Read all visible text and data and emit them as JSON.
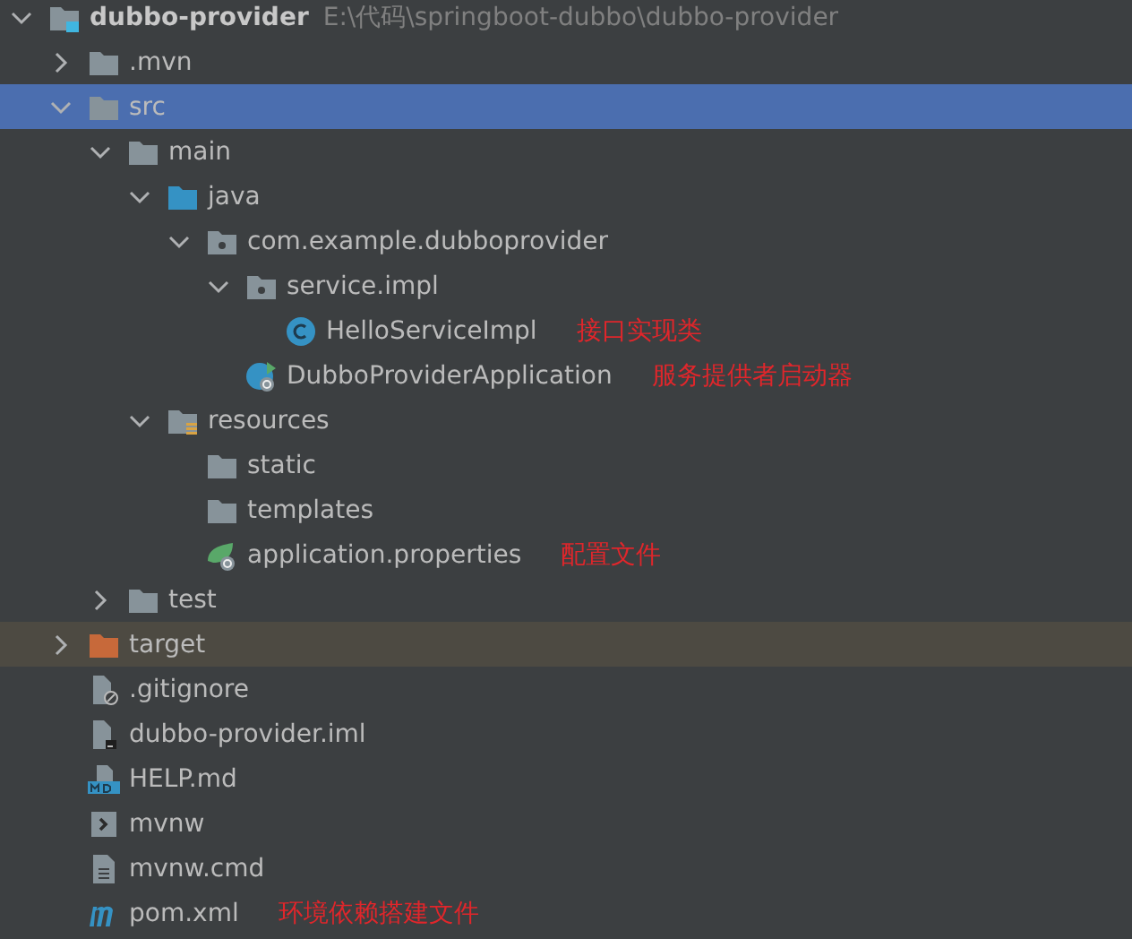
{
  "tree": {
    "label": "dubbo-provider",
    "path": "E:\\代码\\springboot-dubbo\\dubbo-provider",
    "kind": "module",
    "expanded": true,
    "selected": false,
    "children": [
      {
        "label": ".mvn",
        "kind": "folder",
        "expanded": false,
        "selected": false
      },
      {
        "label": "src",
        "kind": "folder",
        "expanded": true,
        "selected": true,
        "children": [
          {
            "label": "main",
            "kind": "folder",
            "expanded": true,
            "selected": false,
            "children": [
              {
                "label": "java",
                "kind": "source-folder",
                "expanded": true,
                "selected": false,
                "children": [
                  {
                    "label": "com.example.dubboprovider",
                    "kind": "package",
                    "expanded": true,
                    "selected": false,
                    "children": [
                      {
                        "label": "service.impl",
                        "kind": "package",
                        "expanded": true,
                        "selected": false,
                        "children": [
                          {
                            "label": "HelloServiceImpl",
                            "kind": "class",
                            "selected": false,
                            "note": "接口实现类"
                          }
                        ]
                      },
                      {
                        "label": "DubboProviderApplication",
                        "kind": "app-class",
                        "selected": false,
                        "note": "服务提供者启动器"
                      }
                    ]
                  }
                ]
              },
              {
                "label": "resources",
                "kind": "resources-folder",
                "expanded": true,
                "selected": false,
                "children": [
                  {
                    "label": "static",
                    "kind": "folder",
                    "selected": false
                  },
                  {
                    "label": "templates",
                    "kind": "folder",
                    "selected": false
                  },
                  {
                    "label": "application.properties",
                    "kind": "properties",
                    "selected": false,
                    "note": "配置文件"
                  }
                ]
              }
            ]
          },
          {
            "label": "test",
            "kind": "folder",
            "expanded": false,
            "selected": false
          }
        ]
      },
      {
        "label": "target",
        "kind": "excluded-folder",
        "expanded": false,
        "selected": false
      },
      {
        "label": ".gitignore",
        "kind": "ignore-file",
        "selected": false
      },
      {
        "label": "dubbo-provider.iml",
        "kind": "iml-file",
        "selected": false
      },
      {
        "label": "HELP.md",
        "kind": "markdown",
        "selected": false
      },
      {
        "label": "mvnw",
        "kind": "script",
        "selected": false
      },
      {
        "label": "mvnw.cmd",
        "kind": "text-file",
        "selected": false
      },
      {
        "label": "pom.xml",
        "kind": "maven",
        "selected": false,
        "note": "环境依赖搭建文件"
      }
    ]
  }
}
